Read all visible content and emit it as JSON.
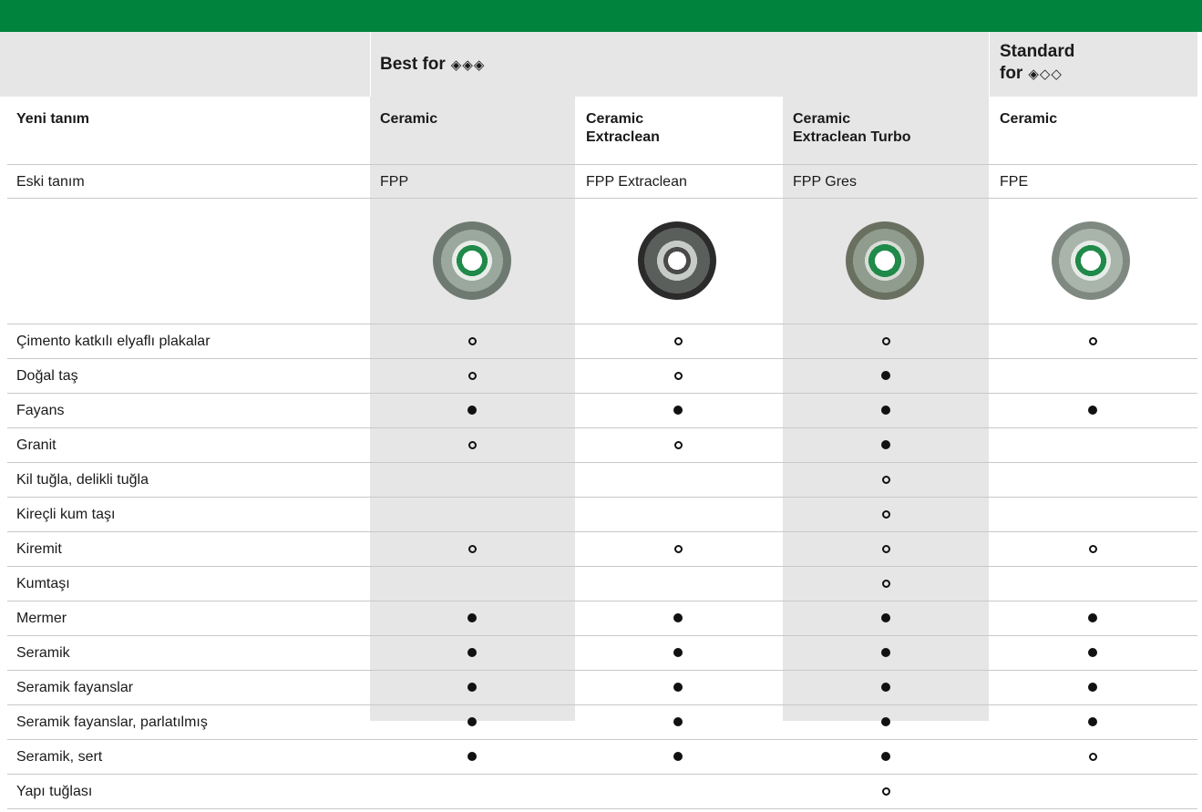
{
  "colors": {
    "brand_green": "#00843d",
    "band_gray": "#e6e6e6",
    "rule": "#c8c8c8"
  },
  "header": {
    "best_label": "Best for",
    "best_icons": "◈◈◈",
    "standard_label_1": "Standard",
    "standard_label_2": "for",
    "standard_icons": "◈◇◇"
  },
  "rows_head": {
    "yeni_label": "Yeni tanım",
    "yeni": [
      [
        "Ceramic",
        ""
      ],
      [
        "Ceramic",
        "Extraclean"
      ],
      [
        "Ceramic",
        "Extraclean Turbo"
      ],
      [
        "Ceramic",
        ""
      ]
    ],
    "eski_label": "Eski tanım",
    "eski": [
      "FPP",
      "FPP Extraclean",
      "FPP Gres",
      "FPE"
    ]
  },
  "products": [
    {
      "icon": "diamond-blade-image"
    },
    {
      "icon": "diamond-blade-image"
    },
    {
      "icon": "diamond-blade-image"
    },
    {
      "icon": "diamond-blade-image"
    }
  ],
  "materials": [
    {
      "name": "Çimento katkılı elyaflı plakalar",
      "marks": [
        "o",
        "o",
        "o",
        "o"
      ]
    },
    {
      "name": "Doğal taş",
      "marks": [
        "o",
        "o",
        "f",
        ""
      ]
    },
    {
      "name": "Fayans",
      "marks": [
        "f",
        "f",
        "f",
        "f"
      ]
    },
    {
      "name": "Granit",
      "marks": [
        "o",
        "o",
        "f",
        ""
      ]
    },
    {
      "name": "Kil tuğla, delikli tuğla",
      "marks": [
        "",
        "",
        "o",
        ""
      ]
    },
    {
      "name": "Kireçli kum taşı",
      "marks": [
        "",
        "",
        "o",
        ""
      ]
    },
    {
      "name": "Kiremit",
      "marks": [
        "o",
        "o",
        "o",
        "o"
      ]
    },
    {
      "name": "Kumtaşı",
      "marks": [
        "",
        "",
        "o",
        ""
      ]
    },
    {
      "name": "Mermer",
      "marks": [
        "f",
        "f",
        "f",
        "f"
      ]
    },
    {
      "name": "Seramik",
      "marks": [
        "f",
        "f",
        "f",
        "f"
      ]
    },
    {
      "name": "Seramik fayanslar",
      "marks": [
        "f",
        "f",
        "f",
        "f"
      ]
    },
    {
      "name": "Seramik fayanslar, parlatılmış",
      "marks": [
        "f",
        "f",
        "f",
        "f"
      ]
    },
    {
      "name": "Seramik, sert",
      "marks": [
        "f",
        "f",
        "f",
        "o"
      ]
    },
    {
      "name": "Yapı tuğlası",
      "marks": [
        "",
        "",
        "o",
        ""
      ]
    }
  ]
}
